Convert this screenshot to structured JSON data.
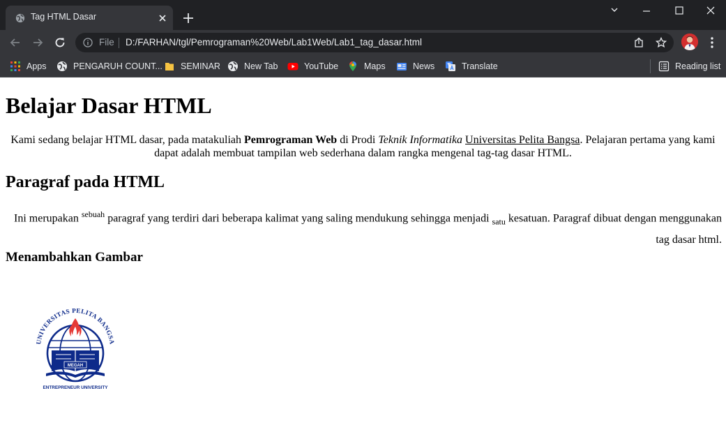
{
  "browser": {
    "tab_title": "Tag HTML Dasar",
    "omnibox_scheme": "File",
    "url": "D:/FARHAN/tgl/Pemrograman%20Web/Lab1Web/Lab1_tag_dasar.html",
    "bookmarks": [
      {
        "label": "Apps",
        "icon": "apps-grid-icon"
      },
      {
        "label": "PENGARUH COUNT...",
        "icon": "globe-icon"
      },
      {
        "label": "SEMINAR",
        "icon": "folder-icon"
      },
      {
        "label": "New Tab",
        "icon": "globe-icon"
      },
      {
        "label": "YouTube",
        "icon": "youtube-icon"
      },
      {
        "label": "Maps",
        "icon": "maps-pin-icon"
      },
      {
        "label": "News",
        "icon": "news-icon"
      },
      {
        "label": "Translate",
        "icon": "translate-icon"
      }
    ],
    "reading_list_label": "Reading list"
  },
  "page": {
    "h1": "Belajar Dasar HTML",
    "p1": {
      "t1": "Kami sedang belajar HTML dasar, pada matakuliah ",
      "bold": "Pemrograman Web",
      "t2": " di Prodi ",
      "italic": "Teknik Informatika",
      "t3": " ",
      "underline": "Universitas Pelita Bangsa",
      "t4": ". Pelajaran pertama yang kami dapat adalah membuat tampilan web sederhana dalam rangka mengenal tag-tag dasar HTML."
    },
    "h2": "Paragraf pada HTML",
    "p2": {
      "t1": "Ini merupakan ",
      "sup": "sebuah",
      "t2": " paragraf yang terdiri dari beberapa kalimat yang saling mendukung sehingga menjadi ",
      "sub": "satu",
      "t3": " kesatuan. Paragraf dibuat dengan menggunakan tag dasar html."
    },
    "h3": "Menambahkan Gambar",
    "logo": {
      "arc_text": "UNIVERSITAS PELITA BANGSA",
      "book_text": "MEGAH",
      "bottom_text": "ENTREPRENEUR UNIVERSITY",
      "color": "#0d2a8a",
      "flame_color": "#e53935"
    }
  }
}
